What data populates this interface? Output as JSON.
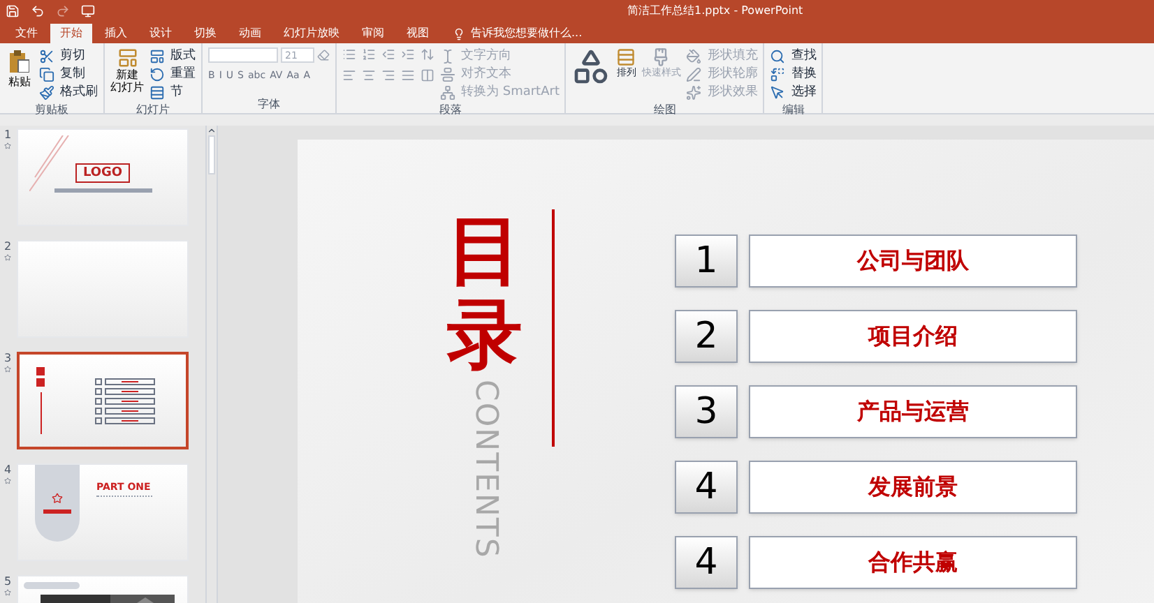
{
  "window": {
    "title": "简洁工作总结1.pptx - PowerPoint"
  },
  "tabs": [
    {
      "label": "文件",
      "selected": false
    },
    {
      "label": "开始",
      "selected": true
    },
    {
      "label": "插入",
      "selected": false
    },
    {
      "label": "设计",
      "selected": false
    },
    {
      "label": "切换",
      "selected": false
    },
    {
      "label": "动画",
      "selected": false
    },
    {
      "label": "幻灯片放映",
      "selected": false
    },
    {
      "label": "审阅",
      "selected": false
    },
    {
      "label": "视图",
      "selected": false
    }
  ],
  "tell_me": {
    "placeholder": "告诉我您想要做什么..."
  },
  "ribbon": {
    "clipboard": {
      "label": "剪贴板",
      "paste": "粘贴",
      "items": [
        {
          "label": "剪切",
          "disabled": false
        },
        {
          "label": "复制",
          "disabled": false
        },
        {
          "label": "格式刷",
          "disabled": false
        }
      ]
    },
    "slides": {
      "label": "幻灯片",
      "new": [
        "新建",
        "幻灯片"
      ],
      "items": [
        {
          "label": "版式",
          "disabled": false
        },
        {
          "label": "重置",
          "disabled": false
        },
        {
          "label": "节",
          "disabled": false
        }
      ]
    },
    "font": {
      "label": "字体",
      "size": "21",
      "buttons": [
        "B",
        "I",
        "U",
        "S",
        "abc",
        "AV",
        "Aa",
        "A"
      ]
    },
    "paragraph": {
      "label": "段落",
      "items": [
        {
          "label": "文字方向",
          "disabled": true
        },
        {
          "label": "对齐文本",
          "disabled": true
        },
        {
          "label": "转换为 SmartArt",
          "disabled": true
        }
      ]
    },
    "drawing": {
      "label": "绘图",
      "large": [
        {
          "label": "排列",
          "disabled": false
        },
        {
          "label": "快速样式",
          "disabled": true
        }
      ],
      "items": [
        {
          "label": "形状填充",
          "disabled": true
        },
        {
          "label": "形状轮廓",
          "disabled": true
        },
        {
          "label": "形状效果",
          "disabled": true
        }
      ]
    },
    "editing": {
      "label": "编辑",
      "items": [
        {
          "label": "查找",
          "disabled": false
        },
        {
          "label": "替换",
          "disabled": false
        },
        {
          "label": "选择",
          "disabled": false
        }
      ]
    }
  },
  "thumbnails": [
    {
      "number": "1",
      "selected": false,
      "kind": "logo",
      "text": "LOGO"
    },
    {
      "number": "2",
      "selected": false,
      "kind": "blank"
    },
    {
      "number": "3",
      "selected": true,
      "kind": "contents"
    },
    {
      "number": "4",
      "selected": false,
      "kind": "part",
      "text": "PART ONE"
    },
    {
      "number": "5",
      "selected": false
    }
  ],
  "slide": {
    "title": [
      "目",
      "录"
    ],
    "subtitle": "CONTENTS",
    "items": [
      {
        "number": "1",
        "label": "公司与团队"
      },
      {
        "number": "2",
        "label": "项目介绍"
      },
      {
        "number": "3",
        "label": "产品与运营"
      },
      {
        "number": "4",
        "label": "发展前景"
      },
      {
        "number": "4",
        "label": "合作共赢"
      }
    ]
  }
}
